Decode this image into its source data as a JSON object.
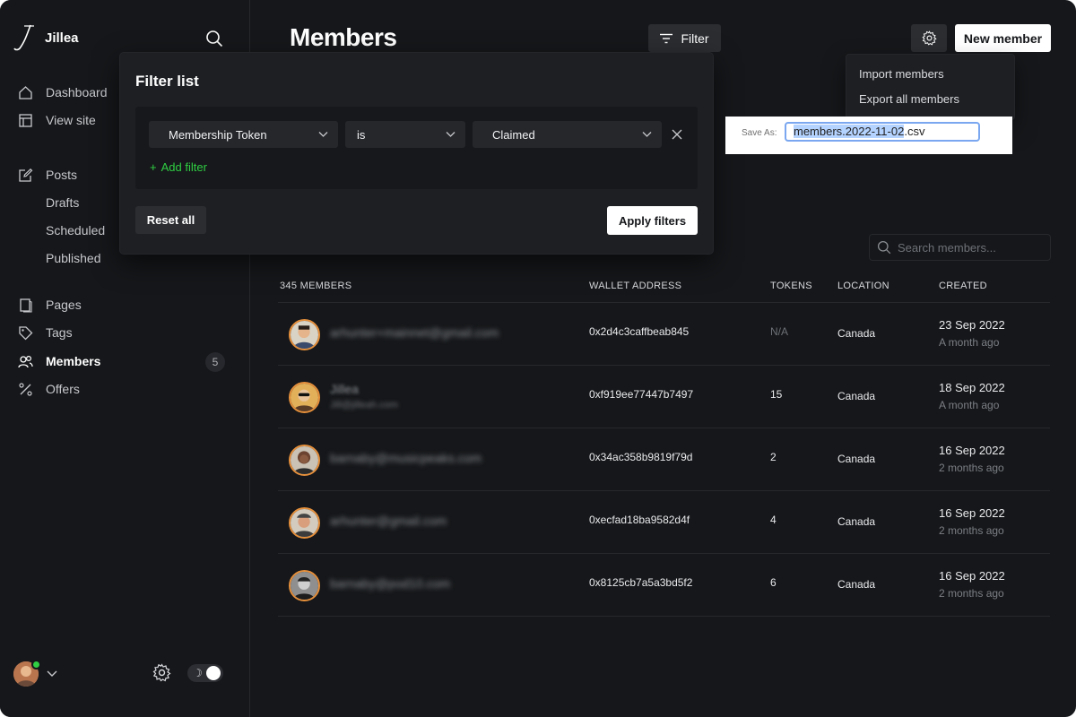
{
  "app": {
    "name": "Jillea"
  },
  "sidebar": {
    "items": [
      {
        "label": "Dashboard",
        "icon": "home-icon"
      },
      {
        "label": "View site",
        "icon": "layout-icon"
      },
      {
        "label": "Posts",
        "icon": "edit-icon"
      },
      {
        "label": "Drafts"
      },
      {
        "label": "Scheduled"
      },
      {
        "label": "Published"
      },
      {
        "label": "Pages",
        "icon": "pages-icon"
      },
      {
        "label": "Tags",
        "icon": "tag-icon"
      },
      {
        "label": "Members",
        "icon": "members-icon",
        "count": "5"
      },
      {
        "label": "Offers",
        "icon": "percent-icon"
      }
    ]
  },
  "header": {
    "title": "Members",
    "filter_label": "Filter",
    "new_member_label": "New member"
  },
  "filter_popup": {
    "title": "Filter list",
    "field": "Membership Token",
    "operator": "is",
    "value": "Claimed",
    "add_filter_label": "Add filter",
    "reset_label": "Reset all",
    "apply_label": "Apply filters"
  },
  "dropdown": {
    "items": [
      "Import members",
      "Export all members"
    ]
  },
  "save_as": {
    "label": "Save As:",
    "filename_selected": "members.2022-11-02",
    "filename_ext": ".csv"
  },
  "search": {
    "placeholder": "Search members..."
  },
  "table": {
    "headers": {
      "members": "345 MEMBERS",
      "wallet": "WALLET ADDRESS",
      "tokens": "TOKENS",
      "location": "LOCATION",
      "created": "CREATED"
    },
    "rows": [
      {
        "email": "arhunter+mainnet@gmail.com",
        "wallet": "0x2d4c3caffbeab845",
        "tokens": "N/A",
        "location": "Canada",
        "date": "23 Sep 2022",
        "ago": "A month ago"
      },
      {
        "name": "Jillea",
        "email": "Jill@jilleah.com",
        "wallet": "0xf919ee77447b7497",
        "tokens": "15",
        "location": "Canada",
        "date": "18 Sep 2022",
        "ago": "A month ago"
      },
      {
        "email": "barnaby@musicpeaks.com",
        "wallet": "0x34ac358b9819f79d",
        "tokens": "2",
        "location": "Canada",
        "date": "16 Sep 2022",
        "ago": "2 months ago"
      },
      {
        "email": "arhunter@gmail.com",
        "wallet": "0xecfad18ba9582d4f",
        "tokens": "4",
        "location": "Canada",
        "date": "16 Sep 2022",
        "ago": "2 months ago"
      },
      {
        "email": "barnaby@pod10.com",
        "wallet": "0x8125cb7a5a3bd5f2",
        "tokens": "6",
        "location": "Canada",
        "date": "16 Sep 2022",
        "ago": "2 months ago"
      }
    ]
  },
  "colors": {
    "background": "#15171a",
    "accent_green": "#30cf43",
    "avatar_ring": "#e58f3b"
  }
}
